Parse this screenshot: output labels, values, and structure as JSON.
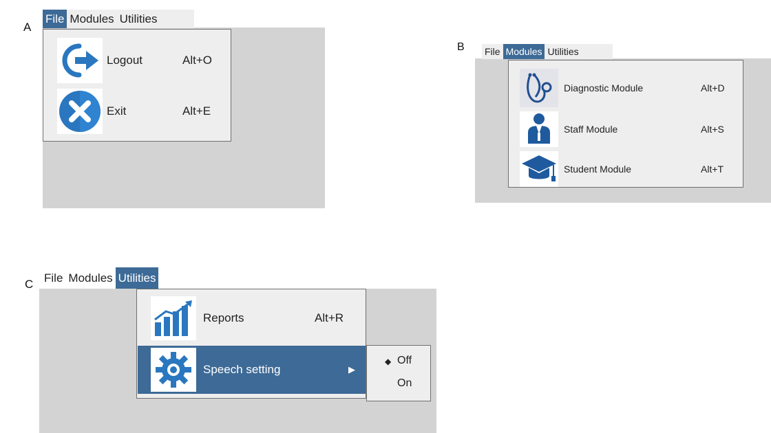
{
  "panels": {
    "a": {
      "letter": "A",
      "menubar": {
        "file": "File",
        "modules": "Modules",
        "utilities": "Utilities"
      },
      "items": [
        {
          "label": "Logout",
          "shortcut": "Alt+O",
          "icon": "logout-icon"
        },
        {
          "label": "Exit",
          "shortcut": "Alt+E",
          "icon": "exit-icon"
        }
      ]
    },
    "b": {
      "letter": "B",
      "menubar": {
        "file": "File",
        "modules": "Modules",
        "utilities": "Utilities"
      },
      "items": [
        {
          "label": "Diagnostic Module",
          "shortcut": "Alt+D",
          "icon": "stethoscope-icon"
        },
        {
          "label": "Staff Module",
          "shortcut": "Alt+S",
          "icon": "staff-person-icon"
        },
        {
          "label": "Student Module",
          "shortcut": "Alt+T",
          "icon": "graduation-cap-icon"
        }
      ]
    },
    "c": {
      "letter": "C",
      "menubar": {
        "file": "File",
        "modules": "Modules",
        "utilities": "Utilities"
      },
      "items": [
        {
          "label": "Reports",
          "shortcut": "Alt+R",
          "icon": "chart-growth-icon"
        },
        {
          "label": "Speech setting",
          "arrow": "▶",
          "icon": "gear-icon"
        }
      ],
      "submenu": {
        "off": "Off",
        "on": "On",
        "selected_marker": "◆"
      }
    }
  },
  "colors": {
    "menu_bg": "#eeeeee",
    "selection": "#3d6a96",
    "window_bg": "#d3d3d3",
    "icon_blue": "#2a77bf"
  }
}
